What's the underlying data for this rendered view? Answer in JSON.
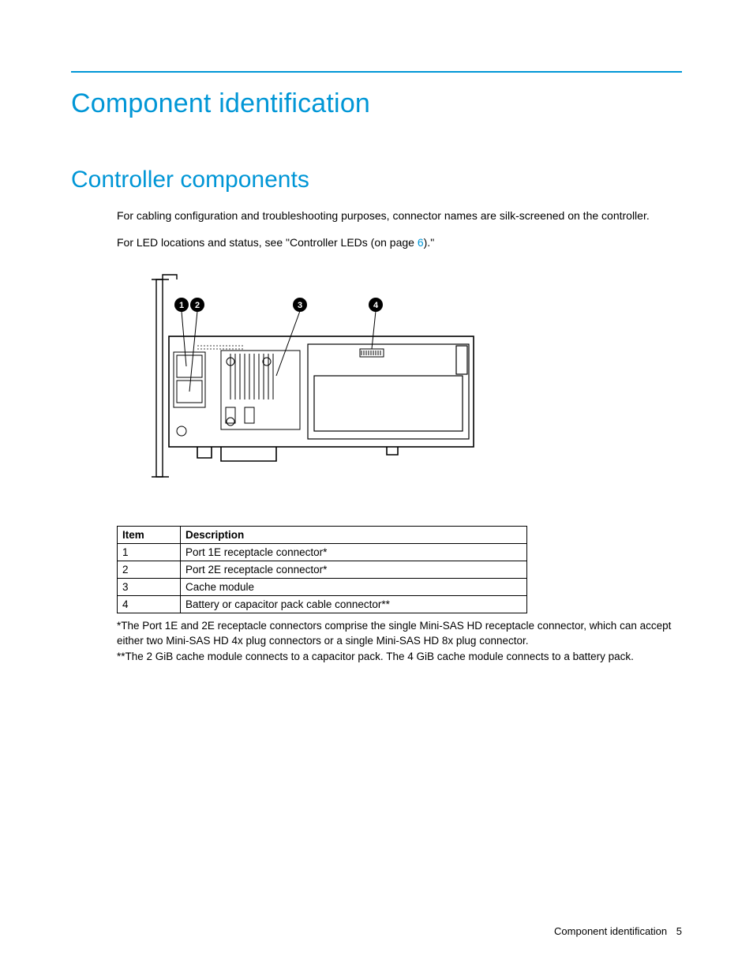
{
  "title": "Component identification",
  "section": "Controller components",
  "para1": "For cabling configuration and troubleshooting purposes, connector names are silk-screened on the controller.",
  "para2_pre": "For LED locations and status, see \"Controller LEDs (on page ",
  "para2_link": "6",
  "para2_post": ").\"",
  "callouts": [
    "1",
    "2",
    "3",
    "4"
  ],
  "table": {
    "headers": {
      "item": "Item",
      "desc": "Description"
    },
    "rows": [
      {
        "item": "1",
        "desc": "Port 1E receptacle connector*"
      },
      {
        "item": "2",
        "desc": "Port 2E receptacle connector*"
      },
      {
        "item": "3",
        "desc": "Cache module"
      },
      {
        "item": "4",
        "desc": "Battery or capacitor pack cable connector**"
      }
    ]
  },
  "footnote1": "*The Port 1E and 2E receptacle connectors comprise the single Mini-SAS HD receptacle connector, which can accept either two Mini-SAS HD 4x plug connectors or a single Mini-SAS HD 8x plug connector.",
  "footnote2": "**The 2 GiB cache module connects to a capacitor pack. The 4 GiB cache module connects to a battery pack.",
  "footer": {
    "label": "Component identification",
    "page": "5"
  }
}
